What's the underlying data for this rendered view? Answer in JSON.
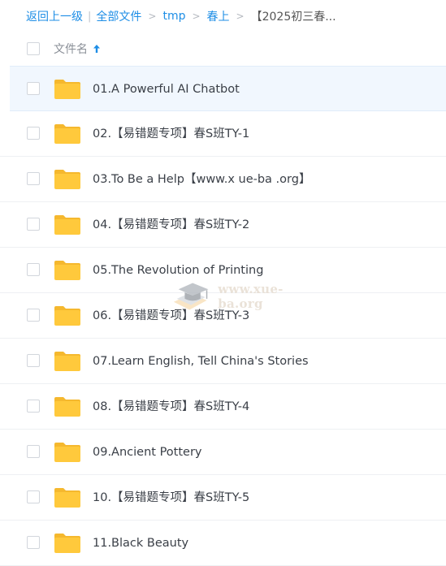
{
  "breadcrumb": {
    "back": "返回上一级",
    "all_files": "全部文件",
    "path": [
      "tmp",
      "春上"
    ],
    "current": "【2025初三春..."
  },
  "header": {
    "column_name": "文件名",
    "sort_icon": "arrow-up-icon"
  },
  "folder_icon": "folder-icon",
  "colors": {
    "link": "#1e8ee6",
    "folder": "#ffc93c",
    "selected_row": "#f1f7fe"
  },
  "rows": [
    {
      "name": "01.A Powerful AI Chatbot"
    },
    {
      "name": "02.【易错题专项】春S班TY-1"
    },
    {
      "name": "03.To Be a Help【www.x ue-ba .org】"
    },
    {
      "name": "04.【易错题专项】春S班TY-2"
    },
    {
      "name": "05.The Revolution of Printing"
    },
    {
      "name": "06.【易错题专项】春S班TY-3"
    },
    {
      "name": "07.Learn English, Tell China's Stories"
    },
    {
      "name": "08.【易错题专项】春S班TY-4"
    },
    {
      "name": "09.Ancient Pottery"
    },
    {
      "name": "10.【易错题专项】春S班TY-5"
    },
    {
      "name": "11.Black Beauty"
    }
  ],
  "watermark": {
    "text": "www.xue-ba.org"
  }
}
